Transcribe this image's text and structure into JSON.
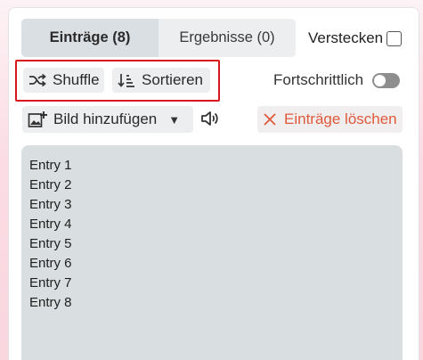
{
  "tabs": {
    "entries_label": "Einträge (8)",
    "results_label": "Ergebnisse (0)"
  },
  "hide": {
    "label": "Verstecken",
    "checked": false
  },
  "actions": {
    "shuffle_label": "Shuffle",
    "sort_label": "Sortieren",
    "advanced_label": "Fortschrittlich",
    "advanced_enabled": false,
    "add_image_label": "Bild hinzufügen",
    "clear_label": "Einträge löschen"
  },
  "icons": {
    "shuffle": "shuffle-icon",
    "sort": "sort-icon",
    "add_image": "add-image-icon",
    "dropdown": "caret-down-icon",
    "sound": "speaker-icon",
    "clear": "close-icon"
  },
  "colors": {
    "highlight_border": "#d9151d",
    "clear_text": "#e0593b",
    "textarea_bg": "#d9dee1"
  },
  "entries": [
    "Entry 1",
    "Entry 2",
    "Entry 3",
    "Entry 4",
    "Entry 5",
    "Entry 6",
    "Entry 7",
    "Entry 8"
  ]
}
